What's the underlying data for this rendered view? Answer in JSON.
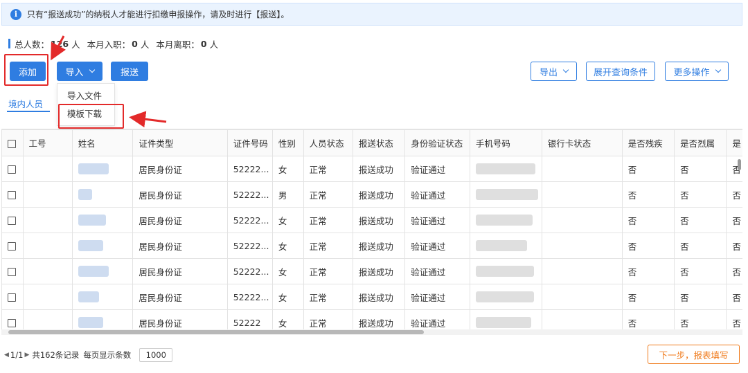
{
  "notice": {
    "icon": "info-icon",
    "text": "只有“报送成功”的纳税人才能进行扣缴申报操作，请及时进行【报送】。"
  },
  "stats": {
    "total_label": "总人数：",
    "total_value": "126",
    "unit1": "人",
    "join_label": "本月入职：",
    "join_value": "0",
    "unit2": "人",
    "leave_label": "本月离职：",
    "leave_value": "0",
    "unit3": "人"
  },
  "toolbar": {
    "add": "添加",
    "import": "导入",
    "submit": "报送",
    "export": "导出",
    "expand_query": "展开查询条件",
    "more_ops": "更多操作"
  },
  "import_menu": {
    "items": [
      "导入文件",
      "模板下载"
    ]
  },
  "tabs": {
    "domestic": "境内人员"
  },
  "table": {
    "columns": [
      "工号",
      "姓名",
      "证件类型",
      "证件号码",
      "性别",
      "人员状态",
      "报送状态",
      "身份验证状态",
      "手机号码",
      "银行卡状态",
      "是否残疾",
      "是否烈属",
      "是"
    ],
    "rows": [
      {
        "id_type": "居民身份证",
        "id_no": "52222...",
        "gender": "女",
        "status": "正常",
        "submit": "报送成功",
        "verify": "验证通过",
        "disabled": "否",
        "martyr": "否",
        "last": "否"
      },
      {
        "id_type": "居民身份证",
        "id_no": "52222...",
        "gender": "男",
        "status": "正常",
        "submit": "报送成功",
        "verify": "验证通过",
        "disabled": "否",
        "martyr": "否",
        "last": "否"
      },
      {
        "id_type": "居民身份证",
        "id_no": "52222...",
        "gender": "女",
        "status": "正常",
        "submit": "报送成功",
        "verify": "验证通过",
        "disabled": "否",
        "martyr": "否",
        "last": "否"
      },
      {
        "id_type": "居民身份证",
        "id_no": "52222...",
        "gender": "女",
        "status": "正常",
        "submit": "报送成功",
        "verify": "验证通过",
        "disabled": "否",
        "martyr": "否",
        "last": "否"
      },
      {
        "id_type": "居民身份证",
        "id_no": "52222...",
        "gender": "女",
        "status": "正常",
        "submit": "报送成功",
        "verify": "验证通过",
        "disabled": "否",
        "martyr": "否",
        "last": "否"
      },
      {
        "id_type": "居民身份证",
        "id_no": "52222...",
        "gender": "女",
        "status": "正常",
        "submit": "报送成功",
        "verify": "验证通过",
        "disabled": "否",
        "martyr": "否",
        "last": "否"
      },
      {
        "id_type": "居民身份证",
        "id_no": "52222",
        "gender": "女",
        "status": "正常",
        "submit": "报送成功",
        "verify": "验证通过",
        "disabled": "否",
        "martyr": "否",
        "last": "否"
      }
    ]
  },
  "pager": {
    "prev_icon": "triangle-left-icon",
    "page": "1/1",
    "next_icon": "triangle-right-icon",
    "total": "共162条记录",
    "per_page_label": "每页显示条数",
    "per_page": "1000"
  },
  "next_button": "下一步，报表填写",
  "colors": {
    "primary": "#2f7de1",
    "annotation": "#e32a2a",
    "next": "#f07a1a"
  }
}
